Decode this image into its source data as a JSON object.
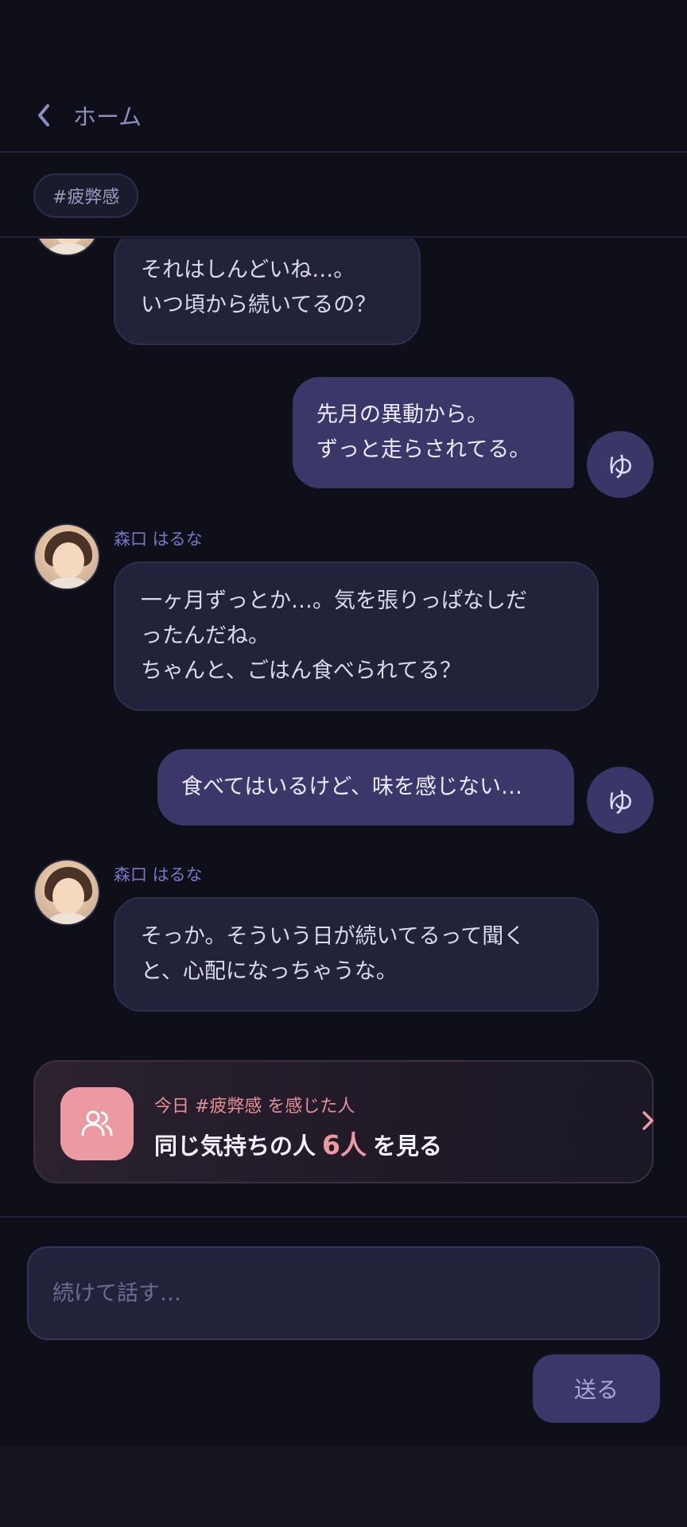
{
  "header": {
    "back_label": "ホーム"
  },
  "tag": {
    "label": "#疲弊感"
  },
  "messages": [
    {
      "from": "other",
      "sender": "",
      "text": "それはしんどいね…。\nいつ頃から続いてるの？"
    },
    {
      "from": "me",
      "avatar": "ゆ",
      "text": "先月の異動から。\nずっと走らされてる。"
    },
    {
      "from": "other",
      "sender": "森口 はるな",
      "text": "一ヶ月ずっとか…。気を張りっぱなしだ\nったんだね。\nちゃんと、ごはん食べられてる？"
    },
    {
      "from": "me",
      "avatar": "ゆ",
      "text": "食べてはいるけど、味を感じない…"
    },
    {
      "from": "other",
      "sender": "森口 はるな",
      "text": "そっか。そういう日が続いてるって聞く\nと、心配になっちゃうな。"
    }
  ],
  "suggest": {
    "sub": "今日 #疲弊感 を感じた人",
    "main_prefix": "同じ気持ちの人",
    "count": "6人",
    "main_suffix": "を見る"
  },
  "composer": {
    "placeholder": "続けて話す…",
    "send_label": "送る"
  },
  "colors": {
    "accent": "#3b3869",
    "pink": "#ec9aa2",
    "background": "#0f0f19"
  }
}
